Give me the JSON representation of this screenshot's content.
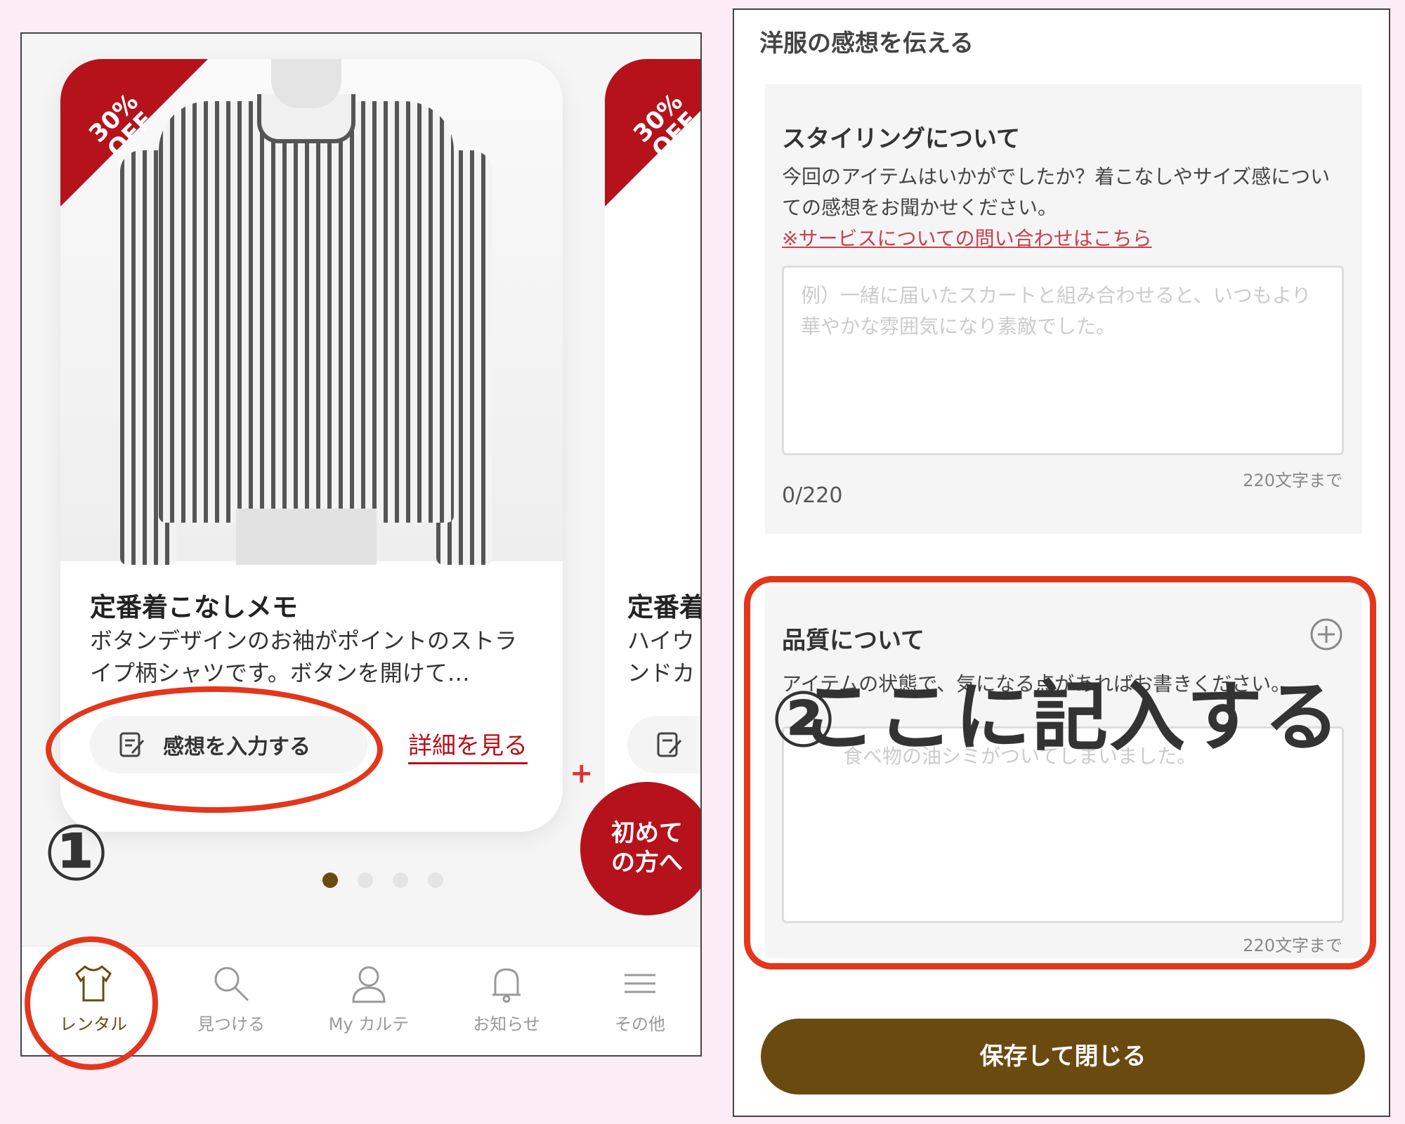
{
  "left": {
    "card": {
      "badge_line1": "30%",
      "badge_line2": "OFF",
      "title": "定番着こなしメモ",
      "description": "ボタンデザインのお袖がポイントのストライプ柄シャツです。ボタンを開けて…",
      "feedback_button": "感想を入力する",
      "detail_link": "詳細を見る"
    },
    "card2": {
      "badge_line1": "30%",
      "badge_line2": "OFF",
      "title": "定番着",
      "description_line1": "ハイウ",
      "description_line2": "ンドカ"
    },
    "first_time_line1": "初めて",
    "first_time_line2": "の方へ",
    "plus": "+",
    "pager": {
      "count": 4,
      "active": 0
    },
    "tabs": [
      {
        "label": "レンタル",
        "icon": "shirt-icon",
        "active": true
      },
      {
        "label": "見つける",
        "icon": "search-icon",
        "active": false
      },
      {
        "label": "My カルテ",
        "icon": "person-icon",
        "active": false
      },
      {
        "label": "お知らせ",
        "icon": "bell-icon",
        "active": false
      },
      {
        "label": "その他",
        "icon": "menu-icon",
        "active": false
      }
    ],
    "annotation_1": "①"
  },
  "right": {
    "heading": "洋服の感想を伝える",
    "styling": {
      "title": "スタイリングについて",
      "description": "今回のアイテムはいかがでしたか？着こなしやサイズ感についての感想をお聞かせください。",
      "contact_link": "※サービスについての問い合わせはこちら",
      "placeholder": "例）一緒に届いたスカートと組み合わせると、いつもより華やかな雰囲気になり素敵でした。",
      "limit": "220文字まで",
      "count": "0/220"
    },
    "quality": {
      "title": "品質について",
      "description": "アイテムの状態で、気になる点があればお書きください。",
      "placeholder": "食べ物の油シミがついてしまいました。",
      "limit": "220文字まで"
    },
    "save_button": "保存して閉じる",
    "annotation_2": "②",
    "annotation_text": "ここに記入する"
  },
  "colors": {
    "brand_red": "#b5121b",
    "brown": "#6b4a10",
    "annotation_red": "#e3361b",
    "background_pink": "#fcecf5"
  }
}
